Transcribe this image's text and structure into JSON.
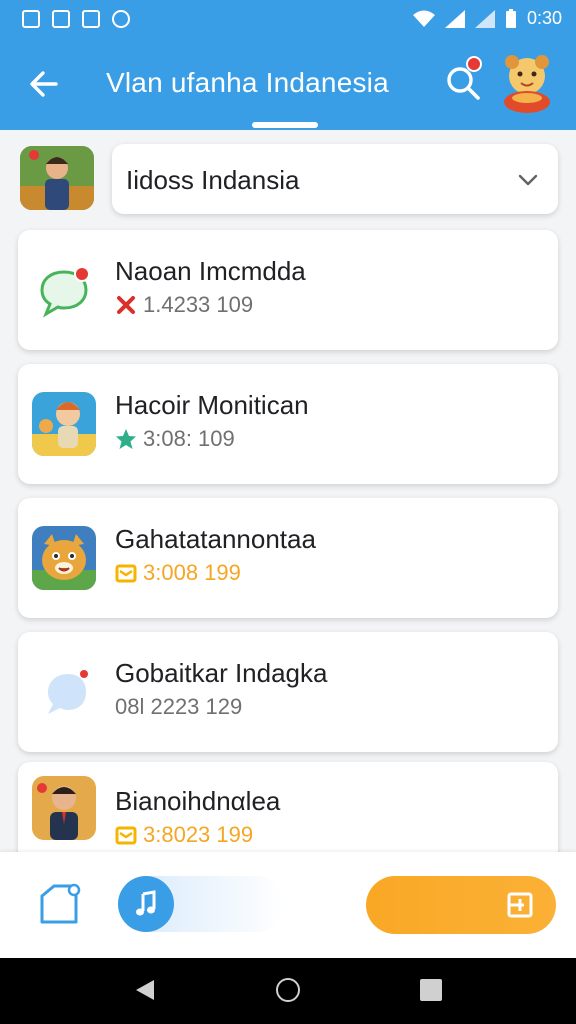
{
  "status_bar": {
    "time": "0:30"
  },
  "app_bar": {
    "title": "Vlan ufanha Indanesia",
    "notification_count": ""
  },
  "selector": {
    "label": "Iidoss Indansia"
  },
  "items": [
    {
      "name": "Naoan Imcmdda",
      "meta": "1.4233 109",
      "icon": "red-x-icon",
      "thumb": "chat-bubble-icon",
      "meta_color": "#707070"
    },
    {
      "name": "Hacoir Monitican",
      "meta": "3:08: 109",
      "icon": "star-icon",
      "thumb": "cartoon-avatar",
      "meta_color": "#707070"
    },
    {
      "name": "Gahatatannontaa",
      "meta": "3:008 199",
      "icon": "yellow-tag-icon",
      "thumb": "tiger-avatar",
      "meta_color": "#f5a623"
    },
    {
      "name": "Gobaitkar Indagka",
      "meta": "08l 2223 129",
      "icon": "",
      "thumb": "speech-bubble-icon",
      "meta_color": "#707070"
    },
    {
      "name": "Bianοihdnαlea",
      "meta": "3:8023 199",
      "icon": "yellow-tag-icon",
      "thumb": "person-avatar",
      "meta_color": "#f5a623"
    }
  ],
  "colors": {
    "primary": "#3a9ee6",
    "accent": "#f9a825",
    "background": "#f3f4f6"
  }
}
